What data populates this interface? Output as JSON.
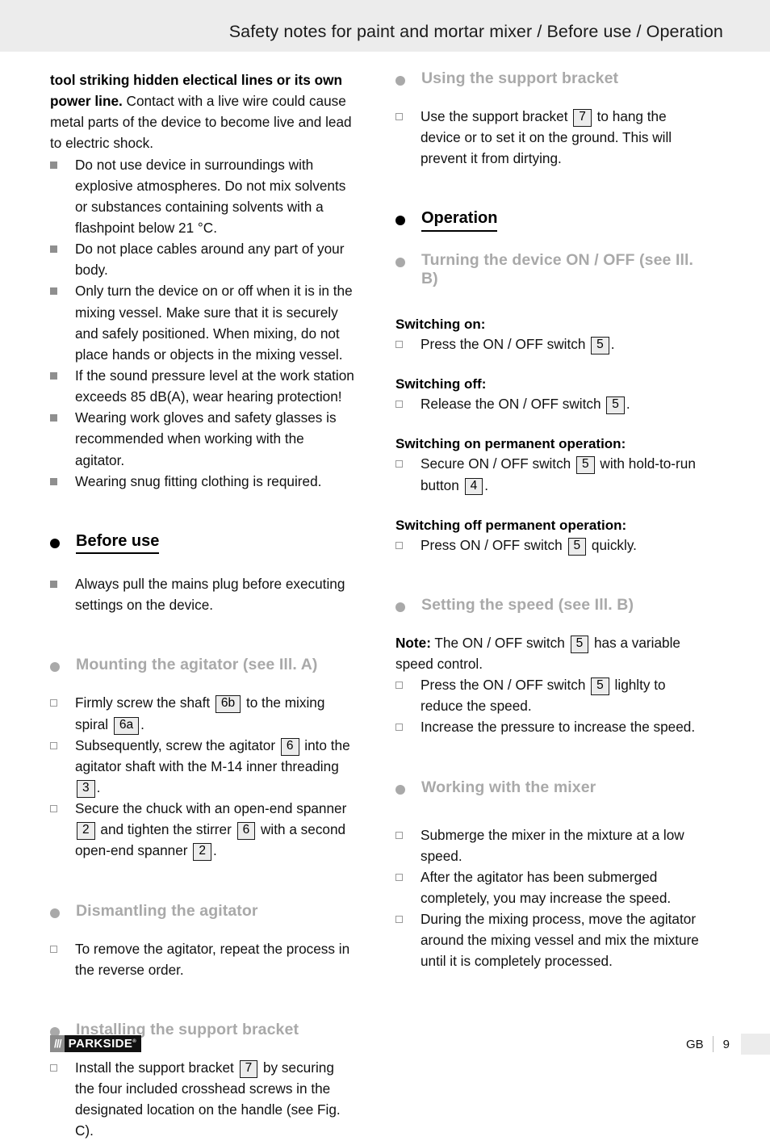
{
  "header": {
    "title": "Safety notes for paint and mortar mixer / Before use / Operation"
  },
  "left_column": {
    "intro": {
      "bold_lead": "tool striking hidden electical lines or its own power line.",
      "rest": " Contact with a live wire could cause metal parts of the device to become live and lead to electric shock."
    },
    "warnings": [
      "Do not use device in surroundings with explosive atmospheres. Do not mix solvents or substances containing solvents with a flashpoint below 21 °C.",
      "Do not place cables around any part of your body.",
      "Only turn the device on or off when it is in the mixing vessel. Make sure that it is securely and safely positioned. When mixing, do not place hands or objects in the mixing vessel.",
      "If the sound pressure level at the work station exceeds 85 dB(A), wear hearing protection!",
      "Wearing work gloves and safety glasses is recommended when working with the agitator.",
      "Wearing snug fitting clothing is required."
    ],
    "before_use": {
      "heading": "Before use",
      "items": [
        "Always pull the mains plug before executing settings on the device."
      ]
    },
    "mounting": {
      "heading": "Mounting the agitator (see Ill. A)",
      "items": [
        {
          "parts": [
            {
              "t": "Firmly screw the shaft "
            },
            {
              "ref": "6b"
            },
            {
              "t": " to the mixing spiral "
            },
            {
              "ref": "6a"
            },
            {
              "t": "."
            }
          ]
        },
        {
          "parts": [
            {
              "t": "Subsequently, screw the agitator "
            },
            {
              "ref": "6"
            },
            {
              "t": " into the agitator shaft with the M-14 inner threading "
            },
            {
              "ref": "3"
            },
            {
              "t": "."
            }
          ]
        },
        {
          "parts": [
            {
              "t": "Secure the chuck with an open-end spanner "
            },
            {
              "ref": "2"
            },
            {
              "t": " and tighten the stirrer "
            },
            {
              "ref": "6"
            },
            {
              "t": " with a second open-end spanner "
            },
            {
              "ref": "2"
            },
            {
              "t": "."
            }
          ]
        }
      ]
    },
    "dismantling": {
      "heading": "Dismantling the agitator",
      "items": [
        "To remove the agitator, repeat the process in the reverse order."
      ]
    },
    "installing": {
      "heading": "Installing the support bracket",
      "items": [
        {
          "parts": [
            {
              "t": "Install the support bracket "
            },
            {
              "ref": "7"
            },
            {
              "t": " by securing the four included crosshead screws in the designated location on the handle (see Fig. C)."
            }
          ]
        }
      ]
    }
  },
  "right_column": {
    "using_bracket": {
      "heading": "Using the support bracket",
      "items": [
        {
          "parts": [
            {
              "t": "Use the support bracket "
            },
            {
              "ref": "7"
            },
            {
              "t": " to hang the device or to set it on the ground. This will prevent it from dirtying."
            }
          ]
        }
      ]
    },
    "operation": {
      "heading": "Operation"
    },
    "turning_on_off": {
      "heading": "Turning the device ON / OFF (see Ill. B)",
      "groups": [
        {
          "label": "Switching on:",
          "items": [
            {
              "parts": [
                {
                  "t": "Press the ON / OFF switch "
                },
                {
                  "ref": "5"
                },
                {
                  "t": "."
                }
              ]
            }
          ]
        },
        {
          "label": "Switching off:",
          "items": [
            {
              "parts": [
                {
                  "t": "Release the ON / OFF switch "
                },
                {
                  "ref": "5"
                },
                {
                  "t": "."
                }
              ]
            }
          ]
        },
        {
          "label": "Switching on permanent operation:",
          "items": [
            {
              "parts": [
                {
                  "t": "Secure ON / OFF switch "
                },
                {
                  "ref": "5"
                },
                {
                  "t": " with hold-to-run button "
                },
                {
                  "ref": "4"
                },
                {
                  "t": "."
                }
              ]
            }
          ]
        },
        {
          "label": "Switching off permanent operation:",
          "items": [
            {
              "parts": [
                {
                  "t": "Press ON / OFF switch "
                },
                {
                  "ref": "5"
                },
                {
                  "t": " quickly."
                }
              ]
            }
          ]
        }
      ]
    },
    "setting_speed": {
      "heading": "Setting the speed (see Ill. B)",
      "note_label": "Note:",
      "note_parts": [
        {
          "t": " The ON / OFF switch "
        },
        {
          "ref": "5"
        },
        {
          "t": " has a variable speed control."
        }
      ],
      "items": [
        {
          "parts": [
            {
              "t": "Press the ON / OFF switch "
            },
            {
              "ref": "5"
            },
            {
              "t": " lighlty to reduce the speed."
            }
          ]
        },
        {
          "parts": [
            {
              "t": "Increase the pressure to increase the speed."
            }
          ]
        }
      ]
    },
    "working": {
      "heading": "Working with the mixer",
      "items": [
        "Submerge the mixer in the mixture at a low speed.",
        "After the agitator has been submerged completely, you may increase the speed.",
        "During the mixing process, move the agitator around the mixing vessel and mix the mixture until it is completely processed."
      ]
    }
  },
  "footer": {
    "brand_slashes": "///",
    "brand_name": "PARKSIDE",
    "brand_reg": "®",
    "locale": "GB",
    "page_number": "9"
  },
  "colors": {
    "header_band": "#ececec",
    "subheading_gray": "#a9a9a9",
    "bullet_square_gray": "#8f8f8f",
    "ref_box_fill": "#ececec"
  }
}
